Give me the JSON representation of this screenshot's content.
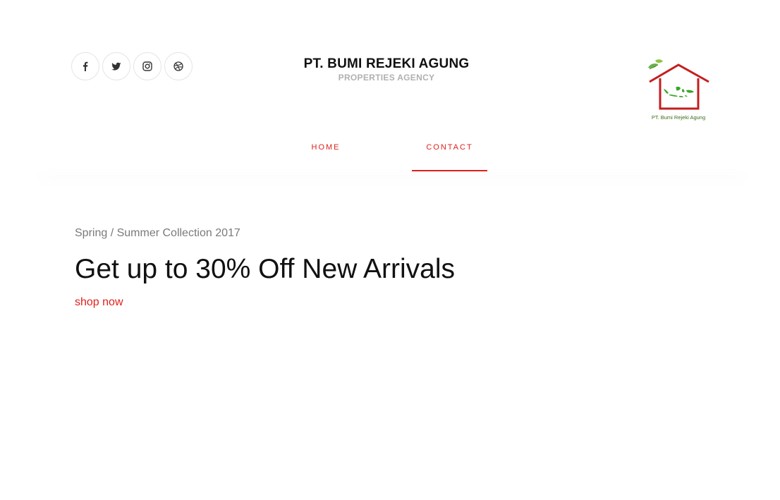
{
  "header": {
    "brand_title": "PT. BUMI REJEKI AGUNG",
    "brand_subtitle": "PROPERTIES AGENCY",
    "logo_caption": "PT. Bumi Rejeki Agung",
    "socials": [
      {
        "icon": "facebook-icon"
      },
      {
        "icon": "twitter-icon"
      },
      {
        "icon": "instagram-icon"
      },
      {
        "icon": "dribbble-icon"
      }
    ]
  },
  "nav": {
    "items": [
      {
        "label": "HOME",
        "active": false
      },
      {
        "label": "CONTACT",
        "active": true
      }
    ]
  },
  "hero": {
    "subtitle": "Spring / Summer Collection 2017",
    "title": "Get up to 30% Off New Arrivals",
    "cta": "shop now"
  },
  "colors": {
    "accent": "#e0201c",
    "title": "#111111",
    "muted": "#7a7a7a",
    "logo_red": "#c41e1e",
    "logo_green": "#3aa52b"
  }
}
